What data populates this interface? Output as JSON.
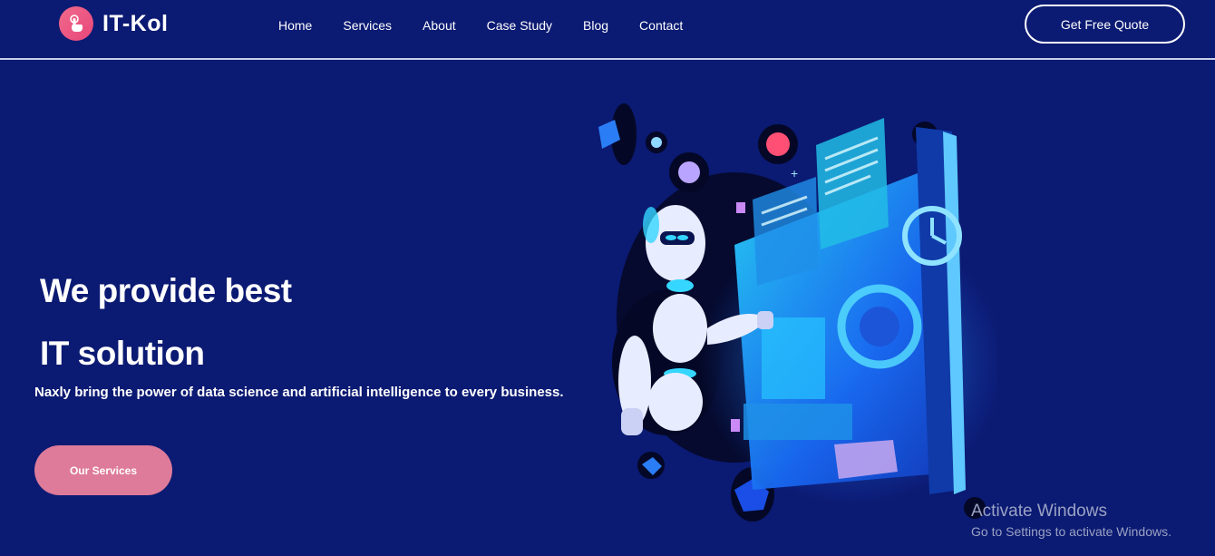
{
  "header": {
    "logo_text": "IT-Kol",
    "logo_icon": "pointer-hand-icon",
    "nav": [
      "Home",
      "Services",
      "About",
      "Case Study",
      "Blog",
      "Contact"
    ],
    "cta_label": "Get Free Quote"
  },
  "hero": {
    "title_line1": "We provide best",
    "title_line2": "IT solution",
    "subtitle": "Naxly bring the power of data science and artificial intelligence to every business.",
    "button_label": "Our Services",
    "illustration": "robot-dashboard-illustration"
  },
  "watermark": {
    "title": "Activate Windows",
    "subtitle": "Go to Settings to activate Windows."
  },
  "colors": {
    "background": "#0b1a72",
    "accent_pink": "#de7a9a",
    "logo_pink": "#e8467a",
    "glow_cyan": "#2fd3ff"
  }
}
